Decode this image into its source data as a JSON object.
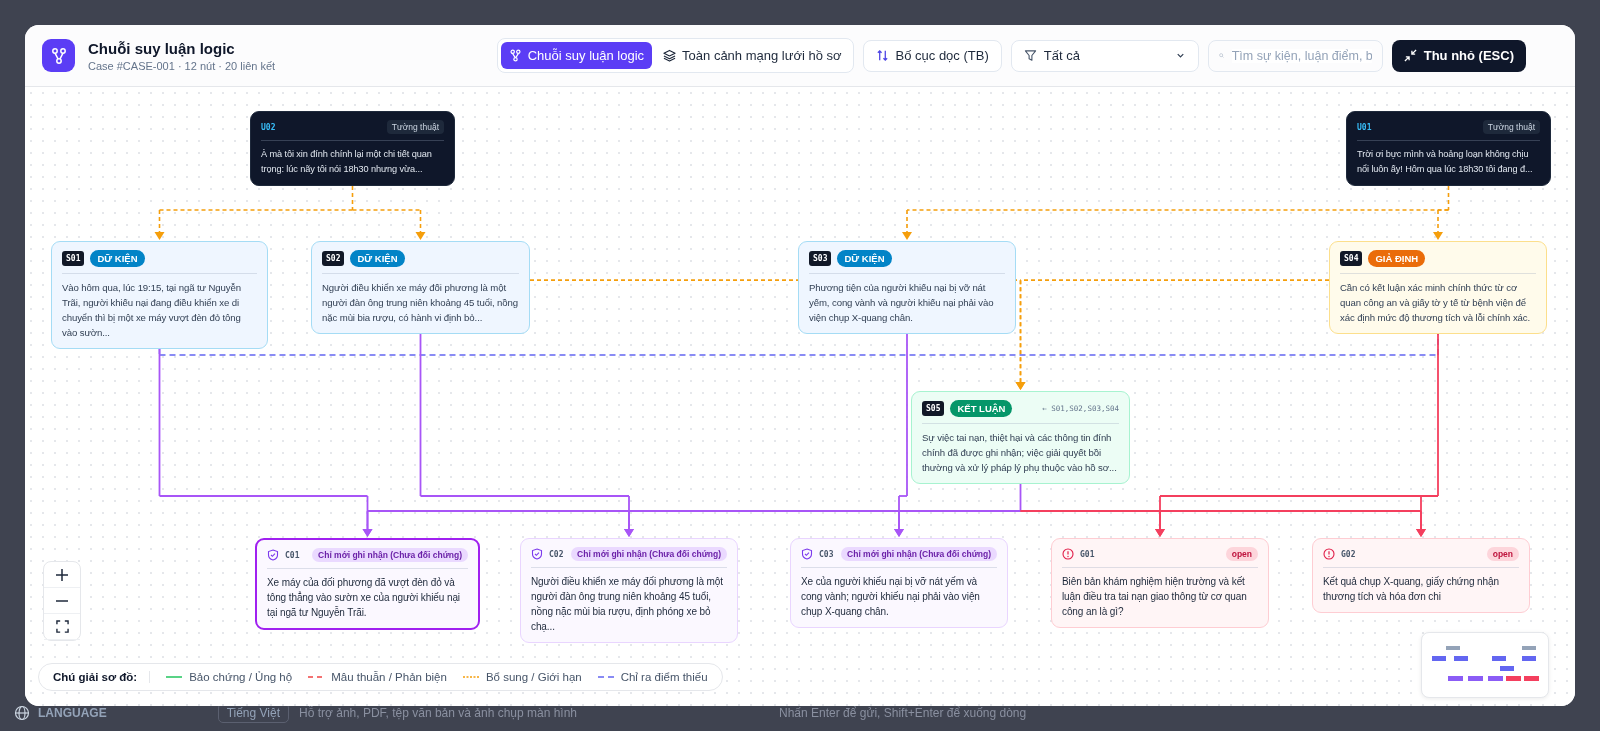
{
  "backdrop": {
    "language_label": "LANGUAGE",
    "language_value": "Tiếng Việt",
    "upload_hint": "Hỗ trợ ảnh, PDF, tệp văn bản và ảnh chụp màn hình",
    "send_hint": "Nhấn Enter để gửi, Shift+Enter để xuống dòng"
  },
  "header": {
    "title": "Chuỗi suy luận logic",
    "subtitle": "Case #CASE-001 · 12 nút · 20 liên kết",
    "view_tabs": [
      {
        "label": "Chuỗi suy luận logic",
        "selected": true
      },
      {
        "label": "Toàn cảnh mạng lưới hồ sơ",
        "selected": false
      }
    ],
    "layout_button": "Bố cục dọc (TB)",
    "filter": {
      "value": "Tất cả"
    },
    "search": {
      "placeholder": "Tìm sự kiện, luận điểm, b"
    },
    "minimize_button": "Thu nhỏ (ESC)"
  },
  "utterances": [
    {
      "id": "U02",
      "tag": "Tường thuật",
      "text": "À mà tôi xin đính chính lại một chi tiết quan trọng: lúc nãy tôi nói 18h30 nhưng vừa..."
    },
    {
      "id": "U01",
      "tag": "Tường thuật",
      "text": "Trời ơi bực mình và hoảng loạn không chịu nổi luôn ấy! Hôm qua lúc 18h30 tôi đang đ..."
    }
  ],
  "statements": [
    {
      "id": "S01",
      "kind": "fact",
      "label": "DỮ KIỆN",
      "text": "Vào hôm qua, lúc 19:15, tại ngã tư Nguyễn Trãi, người khiếu nại đang điều khiển xe di chuyển thì bị một xe máy vượt đèn đỏ tông vào sườn..."
    },
    {
      "id": "S02",
      "kind": "fact",
      "label": "DỮ KIỆN",
      "text": "Người điều khiển xe máy đối phương là một người đàn ông trung niên khoảng 45 tuổi, nồng nặc mùi bia rượu, có hành vi định bỏ..."
    },
    {
      "id": "S03",
      "kind": "fact",
      "label": "DỮ KIỆN",
      "text": "Phương tiện của người khiếu nại bị vỡ nát yếm, cong vành và người khiếu nại phải vào viện chụp X-quang chân."
    },
    {
      "id": "S04",
      "kind": "assumption",
      "label": "GIẢ ĐỊNH",
      "text": "Cần có kết luận xác minh chính thức từ cơ quan công an và giấy tờ y tế từ bệnh viện để xác định mức độ thương tích và lỗi chính xác."
    },
    {
      "id": "S05",
      "kind": "conclusion",
      "label": "KẾT LUẬN",
      "refs": "← S01,S02,S03,S04",
      "text": "Sự việc tai nạn, thiệt hại và các thông tin đính chính đã được ghi nhận; việc giải quyết bồi thường và xử lý pháp lý phụ thuộc vào hồ sơ..."
    }
  ],
  "findings": [
    {
      "id": "C01",
      "kind": "claim",
      "badge": "Chỉ mới ghi nhận (Chưa đối chứng)",
      "selected": true,
      "text": "Xe máy của đối phương đã vượt đèn đỏ và tông thẳng vào sườn xe của người khiếu nại tại ngã tư Nguyễn Trãi."
    },
    {
      "id": "C02",
      "kind": "claim",
      "badge": "Chỉ mới ghi nhận (Chưa đối chứng)",
      "selected": false,
      "text": "Người điều khiển xe máy đối phương là một người đàn ông trung niên khoảng 45 tuổi, nồng nặc mùi bia rượu, định phóng xe bỏ chạ..."
    },
    {
      "id": "C03",
      "kind": "claim",
      "badge": "Chỉ mới ghi nhận (Chưa đối chứng)",
      "selected": false,
      "text": "Xe của người khiếu nại bị vỡ nát yếm và cong vành; người khiếu nại phải vào viện chụp X-quang chân."
    },
    {
      "id": "G01",
      "kind": "question",
      "badge": "open",
      "selected": false,
      "text": "Biên bản khám nghiệm hiện trường và kết luận điều tra tai nạn giao thông từ cơ quan công an là gì?"
    },
    {
      "id": "G02",
      "kind": "question",
      "badge": "open",
      "selected": false,
      "text": "Kết quả chụp X-quang, giấy chứng nhận thương tích và hóa đơn chi"
    }
  ],
  "legend": {
    "title": "Chú giải sơ đồ:",
    "items": [
      {
        "kind": "support",
        "label": "Bảo chứng / Ủng hộ"
      },
      {
        "kind": "contradict",
        "label": "Mâu thuẫn / Phản biện"
      },
      {
        "kind": "supplement",
        "label": "Bổ sung / Giới hạn"
      },
      {
        "kind": "missing",
        "label": "Chỉ ra điểm thiếu"
      }
    ]
  }
}
